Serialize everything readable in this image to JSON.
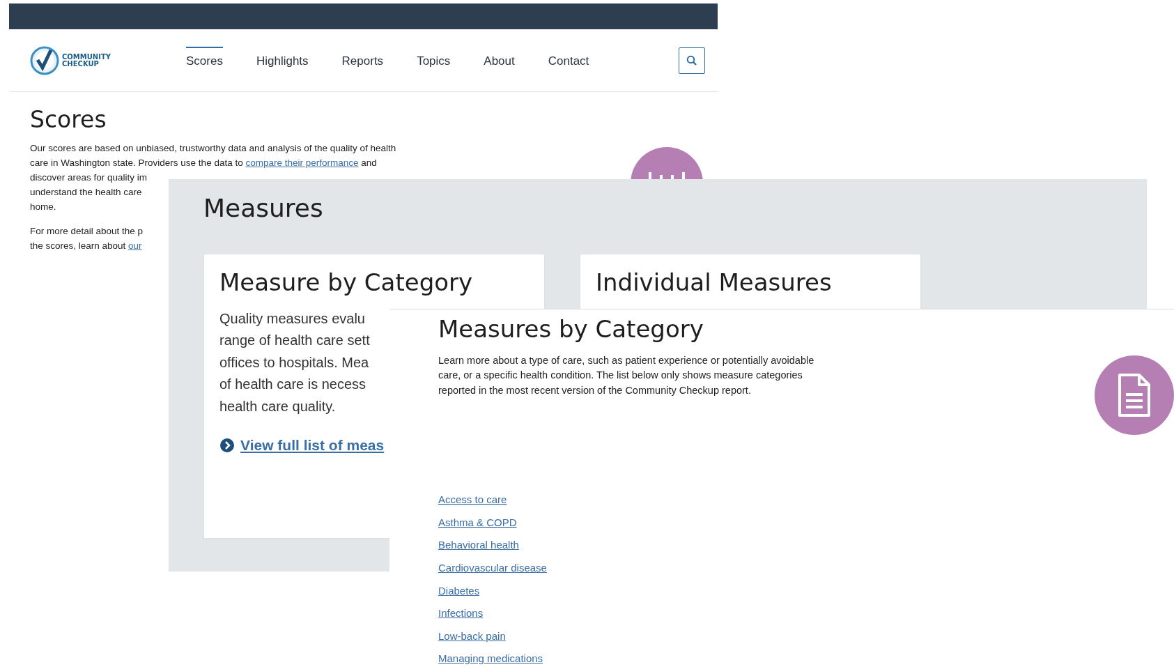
{
  "back_page": {
    "logo_text": [
      "COMMUNITY",
      "CHECKUP"
    ],
    "nav": [
      {
        "label": "Scores",
        "selected": true
      },
      {
        "label": "Highlights",
        "selected": false
      },
      {
        "label": "Reports",
        "selected": false
      },
      {
        "label": "Topics",
        "selected": false
      },
      {
        "label": "About",
        "selected": false
      },
      {
        "label": "Contact",
        "selected": false
      }
    ],
    "title": "Scores",
    "paragraphs": [
      [
        [
          {
            "kind": "text",
            "text": "Our scores are based on unbiased, trustworthy data and analysis of the quality of health"
          }
        ],
        [
          {
            "kind": "text",
            "text": "care in Washington state. Providers use the data to "
          },
          {
            "kind": "link",
            "text": "compare their performance"
          },
          {
            "kind": "text",
            "text": " and"
          }
        ],
        [
          {
            "kind": "text",
            "text": "discover areas for quality im"
          }
        ],
        [
          {
            "kind": "text",
            "text": "understand the health care"
          }
        ],
        [
          {
            "kind": "text",
            "text": "home."
          }
        ]
      ],
      [
        [
          {
            "kind": "text",
            "text": "For more detail about the p"
          }
        ],
        [
          {
            "kind": "text",
            "text": "the scores, learn about "
          },
          {
            "kind": "link",
            "text": "our"
          }
        ]
      ]
    ]
  },
  "middle_page": {
    "title": "Measures",
    "cards": [
      {
        "title": "Measure by Category",
        "lines": [
          "Quality measures evalu",
          "range of health care sett",
          "offices to hospitals. Mea",
          "of health care is necess",
          "health care quality."
        ],
        "link": "View full list of meas"
      },
      {
        "title": "Individual Measures"
      }
    ]
  },
  "front_page": {
    "title": "Measures by Category",
    "description": "Learn more about a type of care, such as patient experience or potentially avoidable care, or a specific health condition. The list below only shows measure categories reported in the most recent version of the Community Checkup report.",
    "links": [
      "Access to care",
      "Asthma & COPD",
      "Behavioral health",
      "Cardiovascular disease",
      "Diabetes",
      "Infections",
      "Low-back pain",
      "Managing medications"
    ]
  }
}
